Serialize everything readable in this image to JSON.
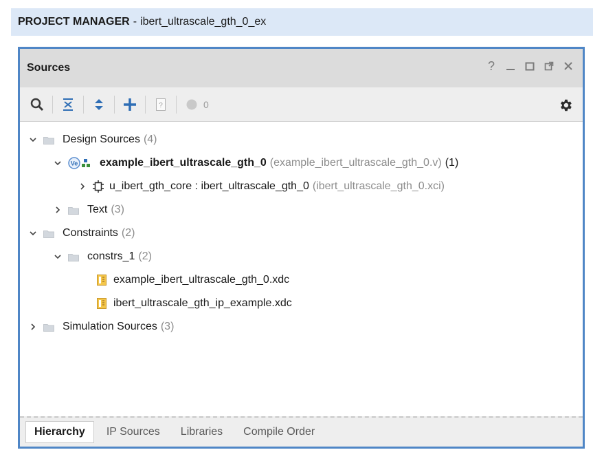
{
  "header": {
    "label": "PROJECT MANAGER",
    "separator": "-",
    "project": "ibert_ultrascale_gth_0_ex"
  },
  "panel": {
    "title": "Sources",
    "controls": {
      "help": "?",
      "minimize": "_",
      "maximize": "□",
      "float": "⧉",
      "close": "×"
    }
  },
  "toolbar": {
    "status_count": "0",
    "icons": [
      "search-icon",
      "collapse-all-icon",
      "expand-all-icon",
      "add-icon",
      "unknown-file-icon",
      "status-circle-icon",
      "gear-icon"
    ]
  },
  "tree": {
    "design_sources": {
      "label": "Design Sources",
      "count": "(4)"
    },
    "top_module": {
      "name": "example_ibert_ultrascale_gth_0",
      "file": "(example_ibert_ultrascale_gth_0.v)",
      "count": "(1)"
    },
    "core": {
      "instance": "u_ibert_gth_core",
      "sep": " : ",
      "module": "ibert_ultrascale_gth_0",
      "file": "(ibert_ultrascale_gth_0.xci)"
    },
    "text": {
      "label": "Text",
      "count": "(3)"
    },
    "constraints": {
      "label": "Constraints",
      "count": "(2)"
    },
    "constrs_1": {
      "label": "constrs_1",
      "count": "(2)"
    },
    "xdc_files": [
      "example_ibert_ultrascale_gth_0.xdc",
      "ibert_ultrascale_gth_ip_example.xdc"
    ],
    "sim_sources": {
      "label": "Simulation Sources",
      "count": "(3)"
    }
  },
  "tabs": [
    "Hierarchy",
    "IP Sources",
    "Libraries",
    "Compile Order"
  ],
  "colors": {
    "accent": "#4f86c6",
    "header_bg": "#dce8f7",
    "folder": "#cfd4da",
    "constraint_icon": "#e3a82b"
  }
}
